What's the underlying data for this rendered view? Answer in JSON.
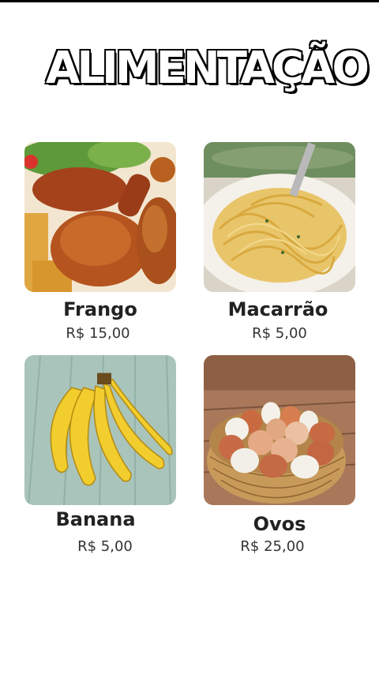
{
  "page": {
    "title": "ALIMENTAÇÃO"
  },
  "products": [
    {
      "name": "Frango",
      "price": "R$ 15,00",
      "image_icon": "roast-chicken-photo"
    },
    {
      "name": "Macarrão",
      "price": "R$ 5,00",
      "image_icon": "spaghetti-photo"
    },
    {
      "name": "Banana",
      "price": "R$ 5,00",
      "image_icon": "bananas-photo"
    },
    {
      "name": "Ovos",
      "price": "R$ 25,00",
      "image_icon": "eggs-basket-photo"
    }
  ]
}
